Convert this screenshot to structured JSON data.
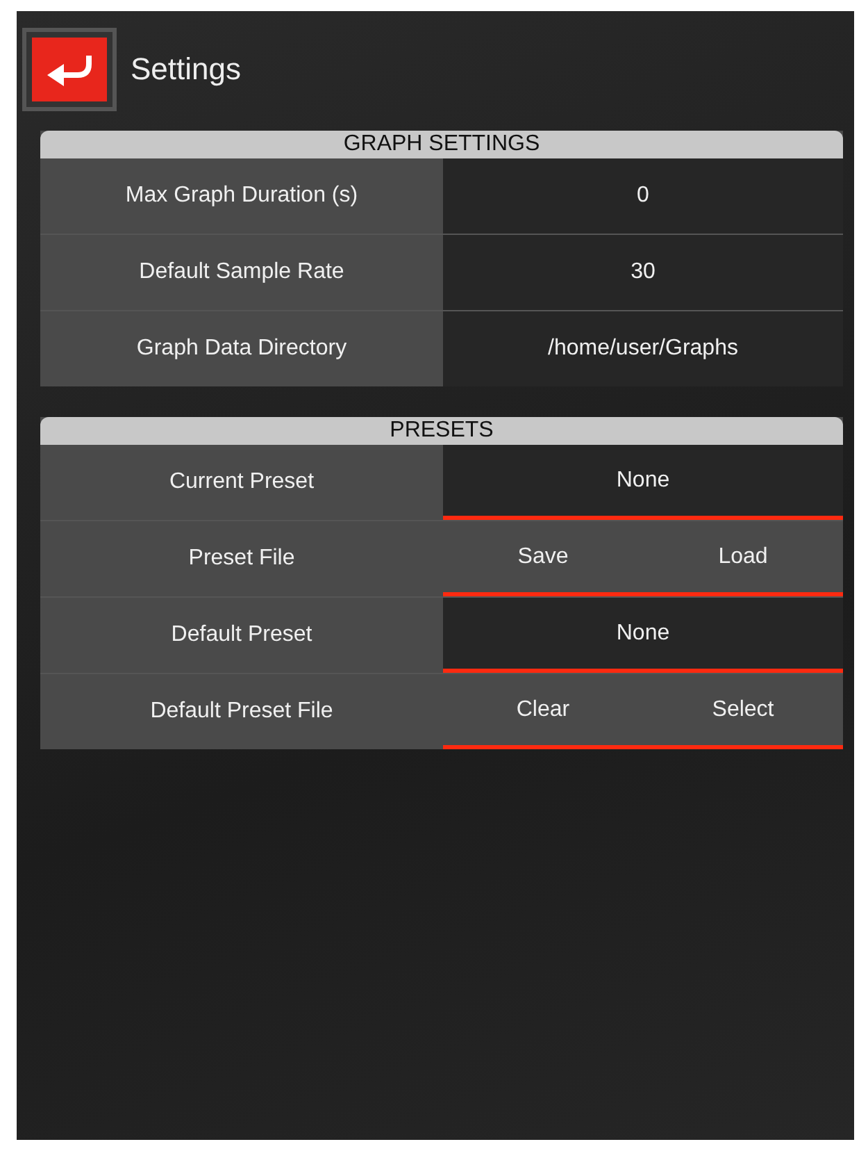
{
  "header": {
    "title": "Settings"
  },
  "sections": [
    {
      "title": "GRAPH SETTINGS",
      "rows": [
        {
          "label": "Max Graph Duration (s)",
          "kind": "input",
          "value": "0"
        },
        {
          "label": "Default Sample Rate",
          "kind": "input",
          "value": "30"
        },
        {
          "label": "Graph Data Directory",
          "kind": "input",
          "value": "/home/user/Graphs"
        }
      ]
    },
    {
      "title": "PRESETS",
      "rows": [
        {
          "label": "Current Preset",
          "kind": "display",
          "value": "None"
        },
        {
          "label": "Preset File",
          "kind": "buttons",
          "buttons": [
            "Save",
            "Load"
          ]
        },
        {
          "label": "Default Preset",
          "kind": "display",
          "value": "None"
        },
        {
          "label": "Default Preset File",
          "kind": "buttons",
          "buttons": [
            "Clear",
            "Select"
          ]
        }
      ]
    }
  ]
}
